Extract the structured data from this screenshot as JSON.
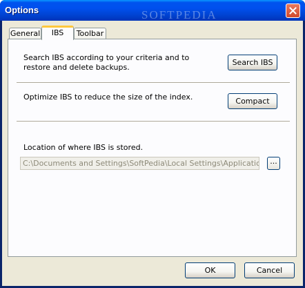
{
  "window": {
    "title": "Options",
    "watermark": "SOFTPEDIA"
  },
  "tabs": [
    {
      "label": "General"
    },
    {
      "label": "IBS",
      "selected": true
    },
    {
      "label": "Toolbar"
    }
  ],
  "ibs": {
    "search_description": "Search IBS according to your criteria and to restore and delete backups.",
    "search_button": "Search IBS",
    "optimize_description": "Optimize IBS to reduce the size of the index.",
    "compact_button": "Compact",
    "location_label": "Location of where IBS is stored.",
    "location_value": "C:\\Documents and Settings\\SoftPedia\\Local Settings\\Application Data",
    "browse_button": "..."
  },
  "footer": {
    "ok_label": "OK",
    "cancel_label": "Cancel"
  },
  "icons": {
    "close": "close-icon"
  }
}
